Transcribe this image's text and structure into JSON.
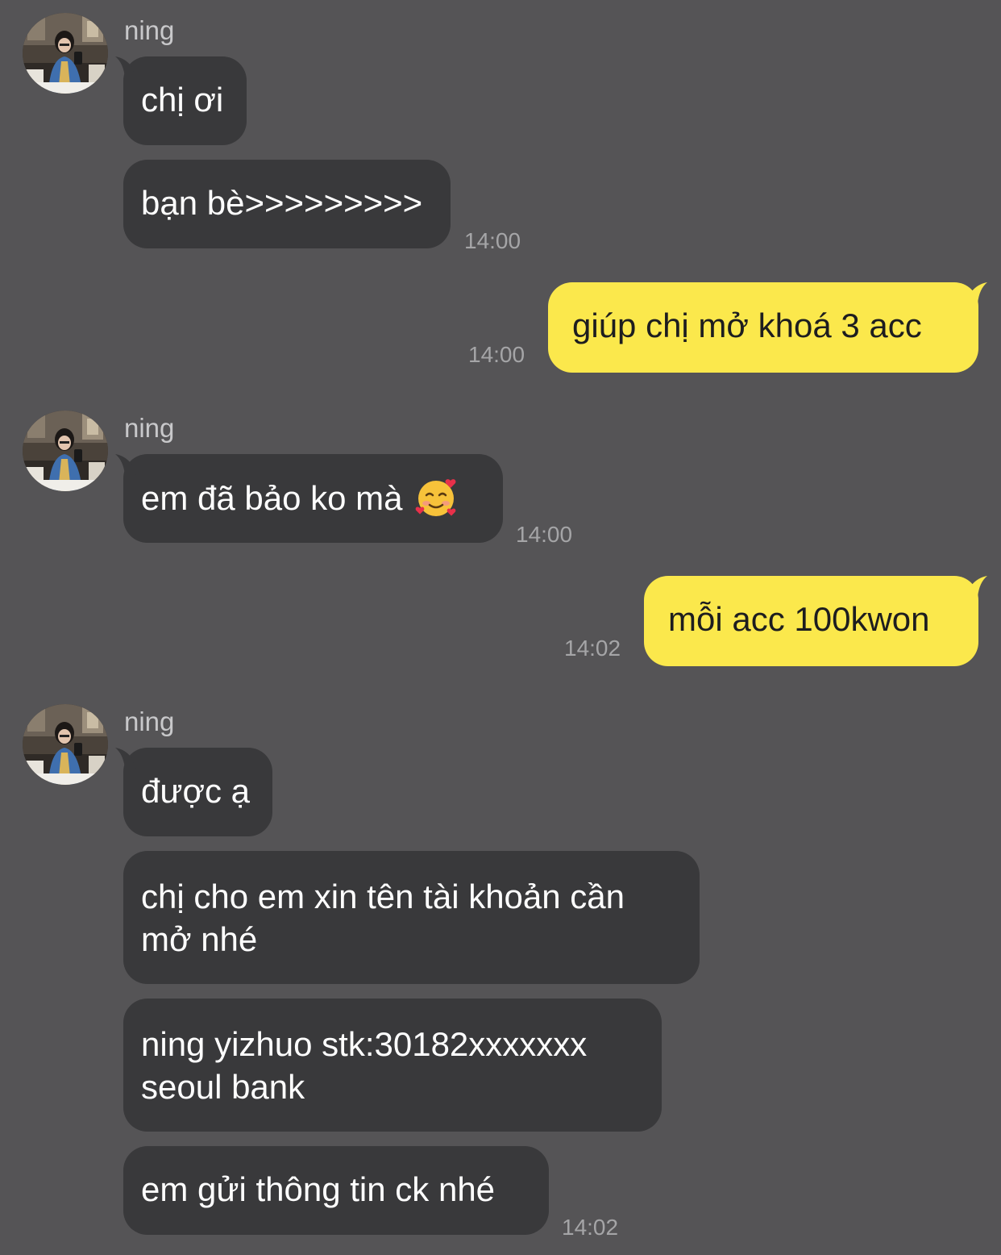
{
  "colors": {
    "background": "#555456",
    "incoming_bubble": "#39393b",
    "outgoing_bubble": "#fbe84c",
    "incoming_text": "#ffffff",
    "outgoing_text": "#1d1d1f",
    "sender_name": "#c8c8ca",
    "timestamp": "#a5a5a7"
  },
  "messages": {
    "group1": {
      "sender": "ning",
      "bubble1": "chị ơi",
      "bubble2": "bạn bè>>>>>>>>>",
      "time": "14:00"
    },
    "out1": {
      "text": "giúp chị mở khoá 3 acc",
      "time": "14:00"
    },
    "group2": {
      "sender": "ning",
      "bubble1": "em đã bảo ko mà",
      "emoji": "smiling-face-with-hearts-icon",
      "time": "14:00"
    },
    "out2": {
      "text": "mỗi acc 100kwon",
      "time": "14:02"
    },
    "group3": {
      "sender": "ning",
      "bubble1": "được ạ",
      "bubble2_line1": "chị cho em xin tên tài khoản cần",
      "bubble2_line2": "mở nhé",
      "bubble3_line1": "ning yizhuo stk:30182xxxxxxx",
      "bubble3_line2": "seoul bank",
      "bubble4": "em gửi thông tin ck nhé",
      "time": "14:02"
    }
  }
}
